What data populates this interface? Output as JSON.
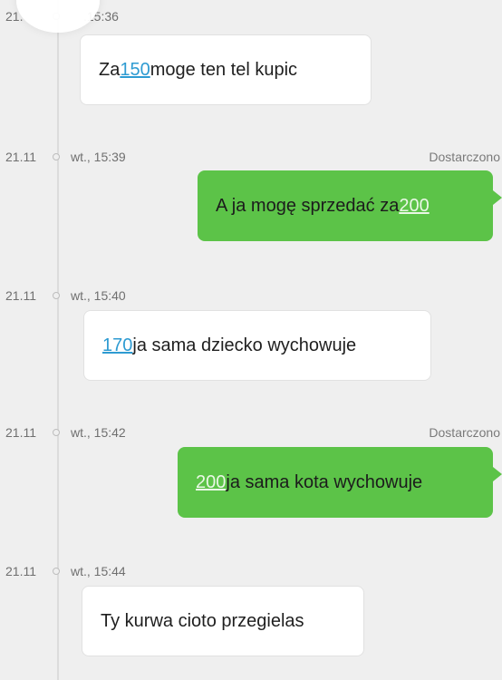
{
  "messages": [
    {
      "date": "21.",
      "time": ".15:36",
      "status": "",
      "direction": "incoming",
      "parts": [
        "Za ",
        "150",
        " moge ten tel kupic"
      ]
    },
    {
      "date": "21.11",
      "time": "wt., 15:39",
      "status": "Dostarczono",
      "direction": "outgoing",
      "parts": [
        "A ja mogę sprzedać za ",
        "200",
        ""
      ]
    },
    {
      "date": "21.11",
      "time": "wt., 15:40",
      "status": "",
      "direction": "incoming",
      "parts": [
        "",
        "170",
        " ja sama dziecko wychowuje"
      ]
    },
    {
      "date": "21.11",
      "time": "wt., 15:42",
      "status": "Dostarczono",
      "direction": "outgoing",
      "parts": [
        "",
        "200",
        " ja sama kota wychowuje"
      ]
    },
    {
      "date": "21.11",
      "time": "wt., 15:44",
      "status": "",
      "direction": "incoming",
      "parts": [
        "Ty kurwa cioto przegielas",
        "",
        ""
      ]
    }
  ],
  "colors": {
    "background": "#efefef",
    "incoming_bubble": "#ffffff",
    "outgoing_bubble": "#5cc348",
    "incoming_link": "#2e9bd2",
    "outgoing_link": "#eaf7e6",
    "timestamp_text": "#6f6f6f"
  },
  "icons": {
    "timeline_dot": "timeline-dot-icon"
  }
}
